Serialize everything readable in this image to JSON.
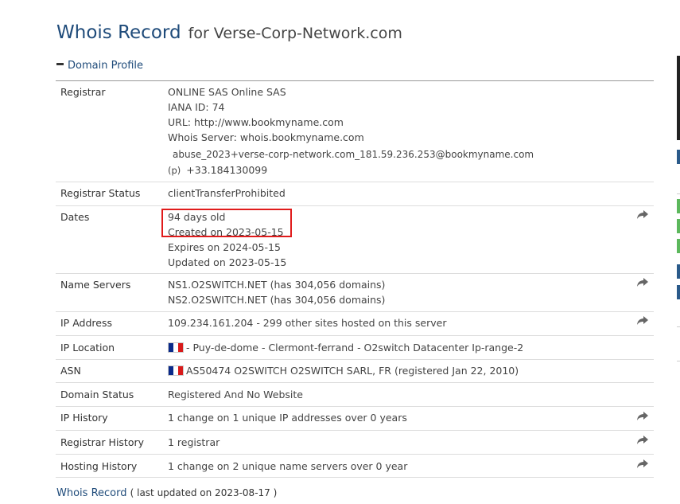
{
  "header": {
    "title": "Whois Record",
    "subtitle": "for Verse-Corp-Network.com"
  },
  "section": {
    "label": "Domain Profile"
  },
  "rows": {
    "registrar": {
      "label": "Registrar",
      "lines": [
        "ONLINE SAS Online SAS",
        "IANA ID: 74",
        "URL: http://www.bookmyname.com",
        "Whois Server: whois.bookmyname.com"
      ],
      "email": "abuse_2023+verse-corp-network.com_181.59.236.253@bookmyname.com",
      "phone_prefix": "(p)",
      "phone": "+33.184130099"
    },
    "registrar_status": {
      "label": "Registrar Status",
      "value": "clientTransferProhibited"
    },
    "dates": {
      "label": "Dates",
      "age": "94 days old",
      "created": "Created on 2023-05-15",
      "expires": "Expires on 2024-05-15",
      "updated": "Updated on 2023-05-15"
    },
    "name_servers": {
      "label": "Name Servers",
      "ns1": "NS1.O2SWITCH.NET (has 304,056 domains)",
      "ns2": "NS2.O2SWITCH.NET (has 304,056 domains)"
    },
    "ip_address": {
      "label": "IP Address",
      "value": "109.234.161.204 - 299 other sites hosted on this server"
    },
    "ip_location": {
      "label": "IP Location",
      "value": "- Puy-de-dome - Clermont-ferrand - O2switch Datacenter Ip-range-2"
    },
    "asn": {
      "label": "ASN",
      "value": "AS50474 O2SWITCH O2SWITCH SARL, FR (registered Jan 22, 2010)"
    },
    "domain_status": {
      "label": "Domain Status",
      "value": "Registered And No Website"
    },
    "ip_history": {
      "label": "IP History",
      "value": "1 change on 1 unique IP addresses over 0 years"
    },
    "registrar_history": {
      "label": "Registrar History",
      "value": "1 registrar"
    },
    "hosting_history": {
      "label": "Hosting History",
      "value": "1 change on 2 unique name servers over 0 year"
    }
  },
  "footer": {
    "link": "Whois Record",
    "note": "( last updated on 2023-08-17 )"
  },
  "icons": {
    "share": "share-arrow-icon",
    "flag": "france-flag-icon",
    "collapse": "minus-icon"
  },
  "colors": {
    "title": "#1f4b7a",
    "highlight": "#e01b1b",
    "edge_green": "#5cb85c",
    "edge_blue": "#2a5a8a"
  }
}
